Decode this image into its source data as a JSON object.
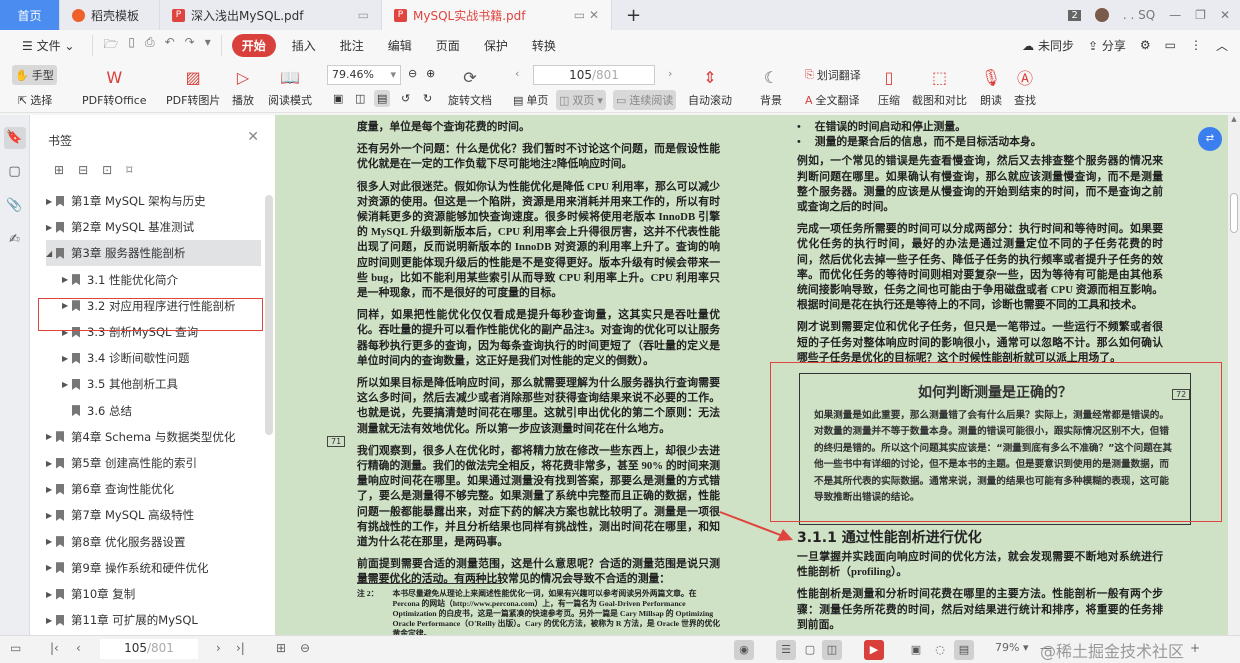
{
  "tabs": {
    "home": "首页",
    "template": "稻壳模板",
    "doc1": "深入浅出MySQL.pdf",
    "doc2": "MySQL实战书籍.pdf",
    "new_tab": "+"
  },
  "window": {
    "badge": "2",
    "user": ". . SQ",
    "minimize": "—",
    "restore": "❐",
    "close": "✕"
  },
  "menu": {
    "file": "文件",
    "items": [
      "开始",
      "插入",
      "批注",
      "编辑",
      "页面",
      "保护",
      "转换"
    ],
    "sync": "未同步",
    "share": "分享"
  },
  "toolbar": {
    "hand": "手型",
    "select": "选择",
    "pdf_office": "PDF转Office",
    "pdf_image": "PDF转图片",
    "play": "播放",
    "read_mode": "阅读模式",
    "zoom": "79.46%",
    "rotate": "旋转文档",
    "page_current": "105",
    "page_total": "/801",
    "single": "单页",
    "double": "双页",
    "continuous": "连续阅读",
    "autoscroll": "自动滚动",
    "background": "背景",
    "word_translate": "划词翻译",
    "full_translate": "全文翻译",
    "compress": "压缩",
    "screenshot": "截图和对比",
    "read_aloud": "朗读",
    "find": "查找"
  },
  "sidebar": {
    "title": "书签",
    "items": [
      {
        "label": "第1章 MySQL 架构与历史",
        "level": 0,
        "arrow": "▶"
      },
      {
        "label": "第2章 MySQL 基准测试",
        "level": 0,
        "arrow": "▶"
      },
      {
        "label": "第3章 服务器性能剖析",
        "level": 0,
        "arrow": "◢"
      },
      {
        "label": "3.1 性能优化简介",
        "level": 1,
        "arrow": "▶"
      },
      {
        "label": "3.2 对应用程序进行性能剖析",
        "level": 1,
        "arrow": "▶"
      },
      {
        "label": "3.3 剖析MySQL 查询",
        "level": 1,
        "arrow": "▶"
      },
      {
        "label": "3.4 诊断间歇性问题",
        "level": 1,
        "arrow": "▶"
      },
      {
        "label": "3.5 其他剖析工具",
        "level": 1,
        "arrow": "▶"
      },
      {
        "label": "3.6 总结",
        "level": 1,
        "arrow": ""
      },
      {
        "label": "第4章 Schema 与数据类型优化",
        "level": 0,
        "arrow": "▶"
      },
      {
        "label": "第5章 创建高性能的索引",
        "level": 0,
        "arrow": "▶"
      },
      {
        "label": "第6章 查询性能优化",
        "level": 0,
        "arrow": "▶"
      },
      {
        "label": "第7章 MySQL 高级特性",
        "level": 0,
        "arrow": "▶"
      },
      {
        "label": "第8章 优化服务器设置",
        "level": 0,
        "arrow": "▶"
      },
      {
        "label": "第9章 操作系统和硬件优化",
        "level": 0,
        "arrow": "▶"
      },
      {
        "label": "第10章 复制",
        "level": 0,
        "arrow": "▶"
      },
      {
        "label": "第11章 可扩展的MySQL",
        "level": 0,
        "arrow": "▶"
      }
    ]
  },
  "left_page": {
    "paragraphs": [
      "度量，单位是每个查询花费的时间。",
      "还有另外一个问题：什么是优化？我们暂时不讨论这个问题，而是假设性能优化就是在一定的工作负载下尽可能地注2降低响应时间。",
      "很多人对此很迷茫。假如你认为性能优化是降低 CPU 利用率，那么可以减少对资源的使用。但这是一个陷阱，资源是用来消耗并用来工作的，所以有时候消耗更多的资源能够加快查询速度。很多时候将使用老版本 InnoDB 引擎的 MySQL 升级到新版本后，CPU 利用率会上升得很厉害，这并不代表性能出现了问题，反而说明新版本的 InnoDB 对资源的利用率上升了。查询的响应时间则更能体现升级后的性能是不是变得更好。版本升级有时候会带来一些 bug，比如不能利用某些索引从而导致 CPU 利用率上升。CPU 利用率只是一种现象，而不是很好的可度量的目标。",
      "同样，如果把性能优化仅仅看成是提升每秒查询量，这其实只是吞吐量优化。吞吐量的提升可以看作性能优化的副产品注3。对查询的优化可以让服务器每秒执行更多的查询，因为每条查询执行的时间更短了（吞吐量的定义是单位时间内的查询数量，这正好是我们对性能的定义的倒数）。",
      "所以如果目标是降低响应时间，那么就需要理解为什么服务器执行查询需要这么多时间，然后去减少或者消除那些对获得查询结果来说不必要的工作。也就是说，先要搞清楚时间花在哪里。这就引申出优化的第二个原则：无法测量就无法有效地优化。所以第一步应该测量时间花在什么地方。",
      "我们观察到，很多人在优化时，都将精力放在修改一些东西上，却很少去进行精确的测量。我们的做法完全相反，将花费非常多，甚至 90% 的时间来测量响应时间花在哪里。如果通过测量没有找到答案，那要么是测量的方式错了，要么是测量得不够完整。如果测量了系统中完整而且正确的数据，性能问题一般都能暴露出来，对症下药的解决方案也就比较明了。测量是一项很有挑战性的工作，并且分析结果也同样有挑战性，测出时间花在哪里，和知道为什么花在那里，是两码事。",
      "前面提到需要合适的测量范围，这是什么意思呢？合适的测量范围是说只测量需要优化的活动。有两种比较常见的情况会导致不合适的测量："
    ],
    "margin_mark": "71",
    "footnote_label": "注 2：",
    "footnote": "本书尽量避免从理论上来阐述性能优化一词，如果有兴趣可以参考阅读另外两篇文章。在 Percona 的网站（http://www.percona.com）上，有一篇名为 Goal-Driven Performance Optimization 的白皮书，这是一篇紧凑的快速参考页。另外一篇是 Cary Millsap 的 Optimizing Oracle Performance（O'Reilly 出版）。Cary 的优化方法，被称为 R 方法，是 Oracle 世界的优化黄金定律。"
  },
  "right_page": {
    "bullets": [
      "在错误的时间启动和停止测量。",
      "测量的是聚合后的信息，而不是目标活动本身。"
    ],
    "paragraphs": [
      "例如，一个常见的错误是先查看慢查询，然后又去排查整个服务器的情况来判断问题在哪里。如果确认有慢查询，那么就应该测量慢查询，而不是测量整个服务器。测量的应该是从慢查询的开始到结束的时间，而不是查询之前或查询之后的时间。",
      "完成一项任务所需要的时间可以分成两部分：执行时间和等待时间。如果要优化任务的执行时间，最好的办法是通过测量定位不同的子任务花费的时间，然后优化去掉一些子任务、降低子任务的执行频率或者提升子任务的效率。而优化任务的等待时间则相对要复杂一些，因为等待有可能是由其他系统间接影响导致，任务之间也可能由于争用磁盘或者 CPU 资源而相互影响。根据时间是花在执行还是等待上的不同，诊断也需要不同的工具和技术。",
      "刚才说到需要定位和优化子任务，但只是一笔带过。一些运行不频繁或者很短的子任务对整体响应时间的影响很小，通常可以忽略不计。那么如何确认哪些子任务是优化的目标呢？这个时候性能剖析就可以派上用场了。"
    ],
    "box_title": "如何判断测量是正确的？",
    "box_text": "如果测量是如此重要，那么测量错了会有什么后果？实际上，测量经常都是错误的。对数量的测量并不等于数量本身。测量的错误可能很小，跟实际情况区别不大，但错的终归是错的。所以这个问题其实应该是：“测量到底有多么不准确？”这个问题在其他一些书中有详细的讨论，但不是本书的主题。但是要意识到使用的是测量数据，而不是其所代表的实际数据。通常来说，测量的结果也可能有多种模糊的表现，这可能导致推断出错误的结论。",
    "margin_mark": "72",
    "section_title": "3.1.1  通过性能剖析进行优化",
    "section_paragraphs": [
      "一旦掌握并实践面向响应时间的优化方法，就会发现需要不断地对系统进行性能剖析（profiling）。",
      "性能剖析是测量和分析时间花费在哪里的主要方法。性能剖析一般有两个步骤：测量任务所花费的时间，然后对结果进行统计和排序，将重要的任务排到前面。"
    ]
  },
  "statusbar": {
    "page_current": "105",
    "page_total": "/801",
    "zoom": "79%",
    "watermark": "@稀土掘金技术社区"
  },
  "colors": {
    "accent": "#d9403b",
    "doc_bg": "#cfe2c6",
    "highlight": "#e0443e",
    "tab_home": "#4a8cf0"
  }
}
